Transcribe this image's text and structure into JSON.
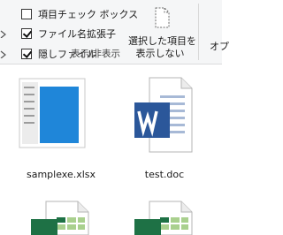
{
  "ribbon": {
    "checkboxes": [
      {
        "label": "項目チェック ボックス",
        "checked": false
      },
      {
        "label": "ファイル名拡張子",
        "checked": true
      },
      {
        "label": "隠しファイル",
        "checked": true
      }
    ],
    "hide_selected": {
      "line1": "選択した項目を",
      "line2": "表示しない"
    },
    "group_label": "表示/非表示",
    "options_label": "オプ"
  },
  "files": [
    {
      "name": "samplexe.xlsx",
      "icon": "screenshot-thumbnail-icon"
    },
    {
      "name": "test.doc",
      "icon": "word-document-icon"
    },
    {
      "name": "",
      "icon": "excel-document-icon"
    },
    {
      "name": "",
      "icon": "excel-document-icon"
    }
  ],
  "colors": {
    "ribbon_bg": "#f5f6f7",
    "word_blue": "#2b579a",
    "excel_green": "#1e7145",
    "thumbnail_blue": "#1f86d9"
  }
}
